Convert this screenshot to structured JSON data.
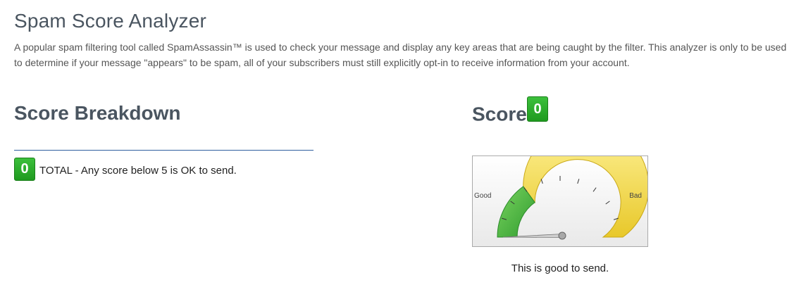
{
  "header": {
    "title": "Spam Score Analyzer",
    "description": "A popular spam filtering tool called SpamAssassin™ is used to check your message and display any key areas that are being caught by the filter. This analyzer is only to be used to determine if your message \"appears\" to be spam, all of your subscribers must still explicitly opt-in to receive information from your account."
  },
  "breakdown": {
    "title": "Score Breakdown",
    "total_score": "0",
    "total_text": "TOTAL - Any score below 5 is OK to send."
  },
  "score": {
    "title": "Score",
    "value": "0",
    "gauge": {
      "good_label": "Good",
      "bad_label": "Bad",
      "min": 0,
      "max": 10,
      "value": 0,
      "good_color": "#3cb83c",
      "bad_color": "#f2d830"
    },
    "verdict": "This is good to send."
  },
  "colors": {
    "heading": "#4a5560",
    "badge_green": "#22a022",
    "divider": "#2f5f9e"
  }
}
